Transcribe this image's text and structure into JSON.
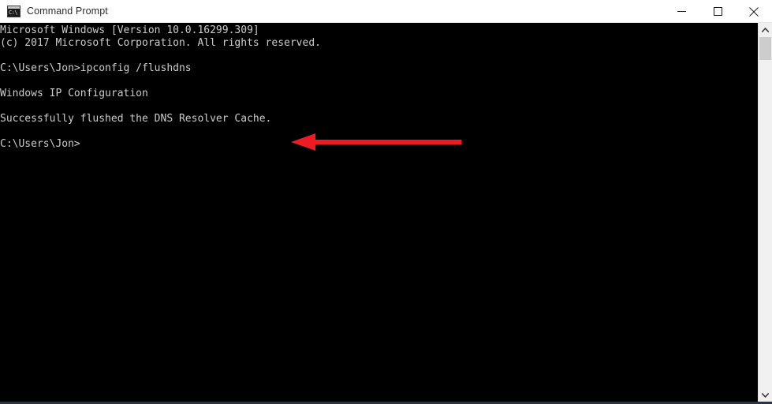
{
  "window": {
    "title": "Command Prompt",
    "icon": "command-prompt-icon",
    "icon_glyph": "C:\\",
    "background_color": "#000000",
    "titlebar_color": "#ffffff",
    "controls": {
      "minimize_label": "Minimize",
      "maximize_label": "Maximize",
      "close_label": "Close"
    }
  },
  "console": {
    "foreground_color": "#cccccc",
    "background_color": "#000000",
    "lines": [
      "Microsoft Windows [Version 10.0.16299.309]",
      "(c) 2017 Microsoft Corporation. All rights reserved.",
      "",
      "C:\\Users\\Jon>ipconfig /flushdns",
      "",
      "Windows IP Configuration",
      "",
      "Successfully flushed the DNS Resolver Cache.",
      "",
      "C:\\Users\\Jon>"
    ],
    "text": "Microsoft Windows [Version 10.0.16299.309]\n(c) 2017 Microsoft Corporation. All rights reserved.\n\nC:\\Users\\Jon>ipconfig /flushdns\n\nWindows IP Configuration\n\nSuccessfully flushed the DNS Resolver Cache.\n\nC:\\Users\\Jon>",
    "prompt": "C:\\Users\\Jon>",
    "command": "ipconfig /flushdns",
    "result": "Successfully flushed the DNS Resolver Cache."
  },
  "annotation": {
    "type": "arrow",
    "direction": "left",
    "color": "#ed1c24",
    "points_at": "Successfully flushed the DNS Resolver Cache."
  },
  "scrollbar": {
    "up_arrow": "scroll-up-icon",
    "down_arrow": "scroll-down-icon",
    "thumb_color": "#cdcdcd",
    "track_color": "#f0f0f0"
  }
}
